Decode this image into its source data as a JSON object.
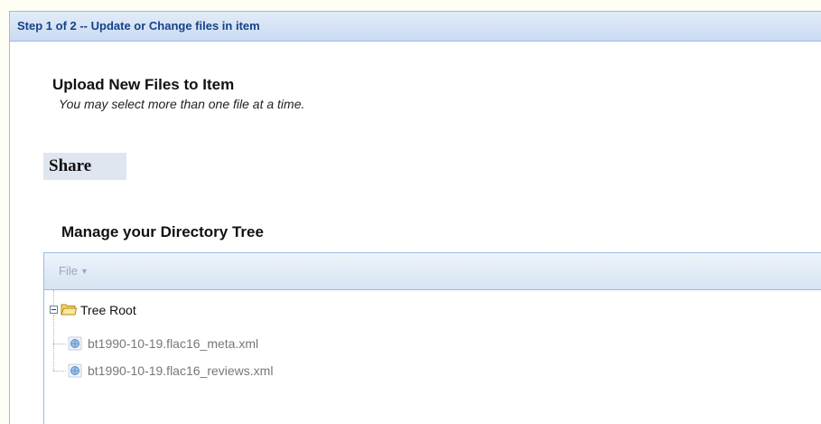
{
  "panel": {
    "title": "Step 1 of 2 -- Update or Change files in item"
  },
  "upload": {
    "heading": "Upload New Files to Item",
    "hint": "You may select more than one file at a time.",
    "share_label": "Share"
  },
  "tree": {
    "heading": "Manage your Directory Tree",
    "menu_label": "File",
    "root_label": "Tree Root",
    "root_icon": "folder-open-icon",
    "file_icon": "xml-file-icon",
    "files": [
      {
        "label": "bt1990-10-19.flac16_meta.xml"
      },
      {
        "label": "bt1990-10-19.flac16_reviews.xml"
      }
    ]
  },
  "colors": {
    "border": "#99bbe8",
    "header_text": "#15428b",
    "page_background": "#fffef5"
  }
}
